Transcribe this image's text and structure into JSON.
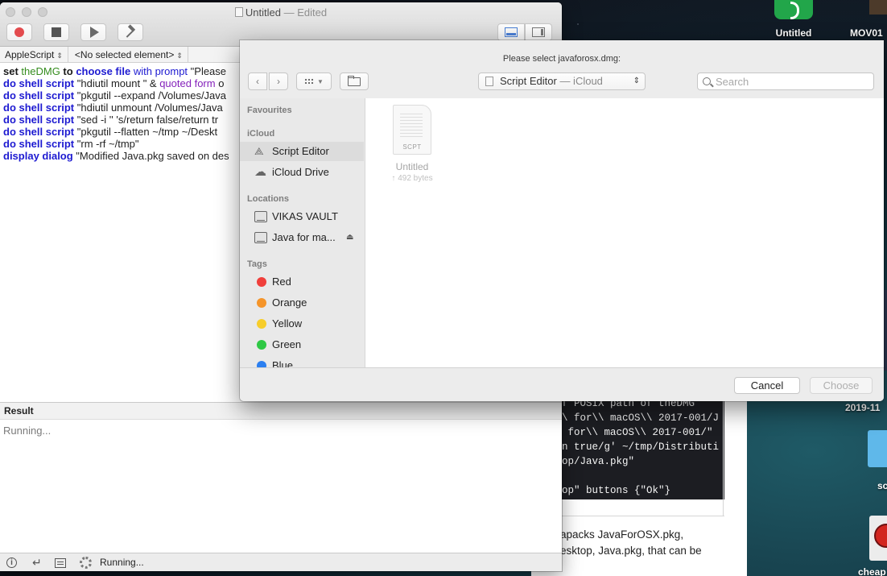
{
  "editor": {
    "title": "Untitled",
    "title_suffix": "— Edited",
    "language_popup": "AppleScript",
    "element_popup": "<No selected element>",
    "script_lines": [
      {
        "parts": [
          {
            "t": "set ",
            "c": "kw"
          },
          {
            "t": "theDMG",
            "c": "var"
          },
          {
            "t": " to ",
            "c": "kw"
          },
          {
            "t": "choose file",
            "c": "cmd"
          },
          {
            "t": " with prompt ",
            "c": "par"
          },
          {
            "t": "\"Please",
            "c": ""
          }
        ]
      },
      {
        "parts": [
          {
            "t": "do shell script",
            "c": "cmd"
          },
          {
            "t": " \"hdiutil mount \" & ",
            "c": ""
          },
          {
            "t": "quoted form",
            "c": "prop"
          },
          {
            "t": " o",
            "c": ""
          }
        ]
      },
      {
        "parts": [
          {
            "t": "do shell script",
            "c": "cmd"
          },
          {
            "t": " \"pkgutil --expand /Volumes/Java",
            "c": ""
          }
        ]
      },
      {
        "parts": [
          {
            "t": "do shell script",
            "c": "cmd"
          },
          {
            "t": " \"hdiutil unmount /Volumes/Java",
            "c": ""
          }
        ]
      },
      {
        "parts": [
          {
            "t": "do shell script",
            "c": "cmd"
          },
          {
            "t": " \"sed -i '' 's/return false/return tr",
            "c": ""
          }
        ]
      },
      {
        "parts": [
          {
            "t": "do shell script",
            "c": "cmd"
          },
          {
            "t": " \"pkgutil --flatten ~/tmp ~/Deskt",
            "c": ""
          }
        ]
      },
      {
        "parts": [
          {
            "t": "do shell script",
            "c": "cmd"
          },
          {
            "t": " \"rm -rf ~/tmp\"",
            "c": ""
          }
        ]
      },
      {
        "parts": [
          {
            "t": "display dialog",
            "c": "cmd"
          },
          {
            "t": " \"Modified Java.pkg saved on des",
            "c": ""
          }
        ]
      }
    ],
    "result_label": "Result",
    "result_text": "Running...",
    "status_text": "Running..."
  },
  "panel": {
    "prompt": "Please select javaforosx.dmg:",
    "location_name": "Script Editor",
    "location_sep": "— iCloud",
    "search_placeholder": "Search",
    "sidebar": {
      "favourites_header": "Favourites",
      "icloud_header": "iCloud",
      "icloud_items": [
        {
          "label": "Script Editor",
          "icon": "script-editor-icon",
          "selected": true
        },
        {
          "label": "iCloud Drive",
          "icon": "cloud-icon",
          "selected": false
        }
      ],
      "locations_header": "Locations",
      "location_items": [
        {
          "label": "VIKAS VAULT",
          "icon": "drive-icon",
          "eject": false
        },
        {
          "label": "Java for ma...",
          "icon": "drive-icon",
          "eject": true
        }
      ],
      "tags_header": "Tags",
      "tags": [
        {
          "label": "Red",
          "color": "#f03f3b"
        },
        {
          "label": "Orange",
          "color": "#f5952a"
        },
        {
          "label": "Yellow",
          "color": "#f7cd2b"
        },
        {
          "label": "Green",
          "color": "#2fc845"
        },
        {
          "label": "Blue",
          "color": "#2b7ff0"
        }
      ]
    },
    "file": {
      "name": "Untitled",
      "size": "↑ 492 bytes",
      "badge": "SCPT"
    },
    "cancel_label": "Cancel",
    "choose_label": "Choose"
  },
  "browser": {
    "code_lines": [
      "f POSIX path of theDMG",
      "\\ for\\\\ macOS\\\\ 2017-001/J",
      " for\\\\ macOS\\\\ 2017-001/\"",
      "n true/g' ~/tmp/Distributi",
      "op/Java.pkg\"",
      "",
      "op\" buttons {\"Ok\"}"
    ],
    "desc_lines": [
      "apacks JavaForOSX.pkg,",
      "esktop, Java.pkg, that can be"
    ]
  },
  "desktop": {
    "untitled_label": "Untitled",
    "mov_label": "MOV01",
    "date_label": "2019-11",
    "sc_label": "sc",
    "cheap_label": "cheap"
  }
}
